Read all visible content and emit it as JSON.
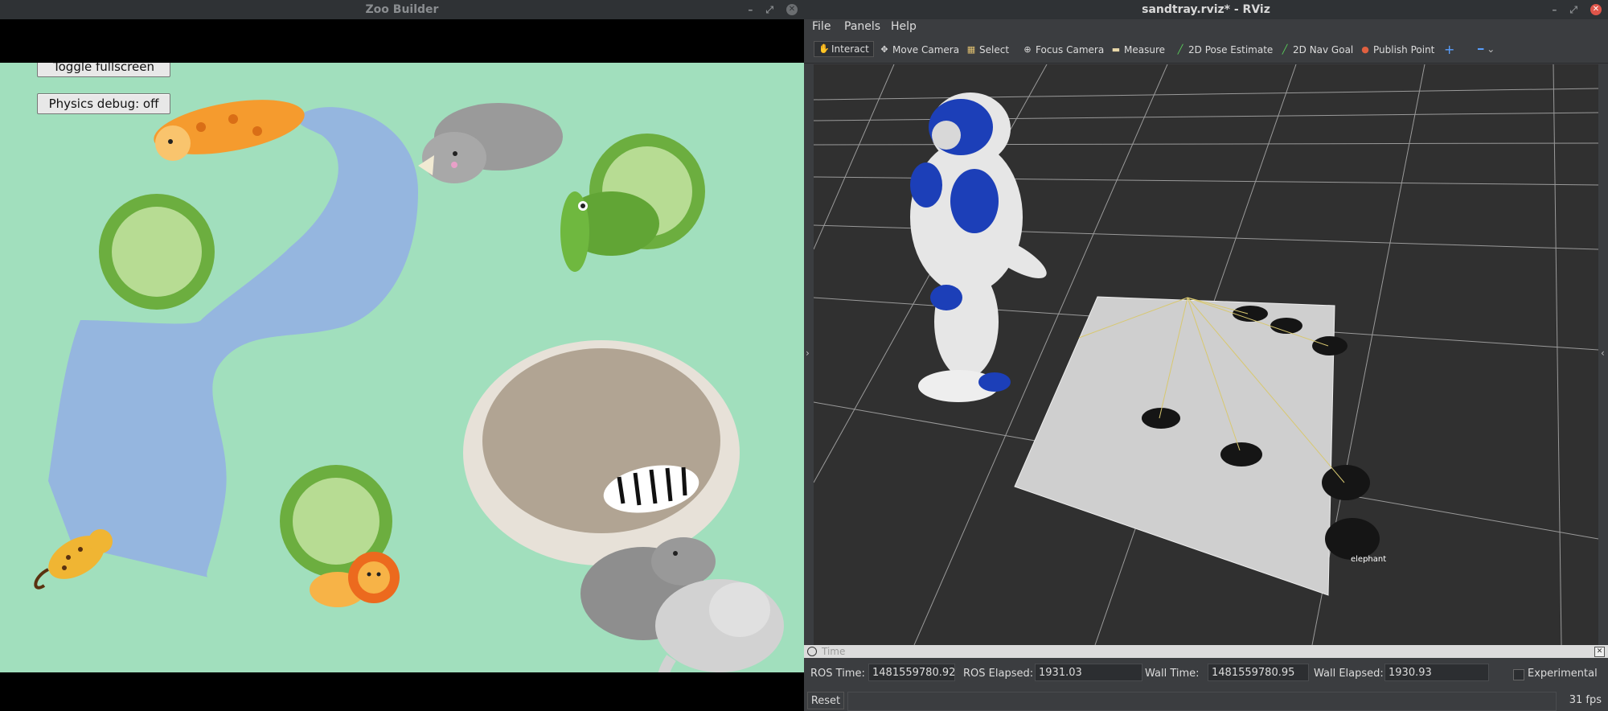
{
  "zoo": {
    "title": "Zoo Builder",
    "buttons": {
      "fullscreen": "Toggle fullscreen",
      "physics": "Physics debug: off"
    }
  },
  "rviz": {
    "title": "sandtray.rviz* - RViz",
    "menu": {
      "file": "File",
      "panels": "Panels",
      "help": "Help"
    },
    "tools": {
      "interact": "Interact",
      "move_camera": "Move Camera",
      "select": "Select",
      "focus_camera": "Focus Camera",
      "measure": "Measure",
      "pose_estimate": "2D Pose Estimate",
      "nav_goal": "2D Nav Goal",
      "publish_point": "Publish Point"
    },
    "scene_labels": {
      "elephant": "elephant"
    },
    "time_panel": {
      "label": "Time",
      "ros_time_label": "ROS Time:",
      "ros_time": "1481559780.92",
      "ros_elapsed_label": "ROS Elapsed:",
      "ros_elapsed": "1931.03",
      "wall_time_label": "Wall Time:",
      "wall_time": "1481559780.95",
      "wall_elapsed_label": "Wall Elapsed:",
      "wall_elapsed": "1930.93",
      "experimental_label": "Experimental"
    },
    "reset_label": "Reset",
    "fps": "31 fps"
  },
  "colors": {
    "grass": "#a1dfbd",
    "water": "#95b6df",
    "tree_dark": "#6cae3f",
    "tree_light": "#b7dc93",
    "enclosure_outer": "#e7e1d8",
    "enclosure_inner": "#b1a493",
    "robot_blue": "#1c3fb8"
  }
}
